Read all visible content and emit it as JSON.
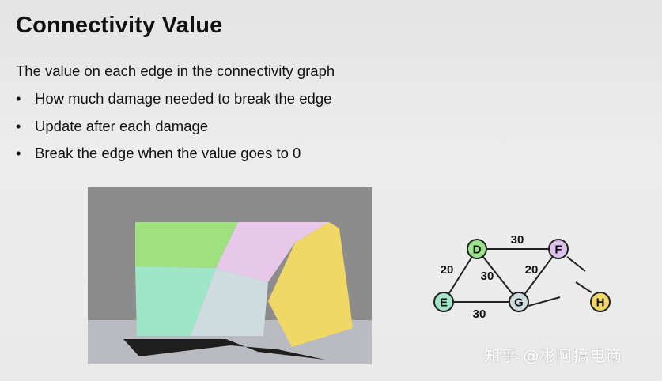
{
  "slide": {
    "title": "Connectivity Value",
    "intro": "The value on each edge in the connectivity graph",
    "bullets": [
      {
        "marker": "•",
        "text": "How much damage needed to break the edge"
      },
      {
        "marker": "•",
        "text": "Update after each damage"
      },
      {
        "marker": "•",
        "text": "Break the edge when the value goes to 0"
      }
    ]
  },
  "figure": {
    "piece_colors": {
      "green": "#9fe07f",
      "pink": "#e8c8e8",
      "teal": "#9fe6c8",
      "gray": "#cfdcdf",
      "yellow": "#f0d866"
    }
  },
  "graph": {
    "nodes": [
      {
        "id": "D",
        "color": "#9be38a"
      },
      {
        "id": "F",
        "color": "#dcc2ec"
      },
      {
        "id": "E",
        "color": "#9fe6c8"
      },
      {
        "id": "G",
        "color": "#cfdcdf"
      },
      {
        "id": "H",
        "color": "#f0d866"
      }
    ],
    "edges": [
      {
        "from": "D",
        "to": "F",
        "label": "30"
      },
      {
        "from": "D",
        "to": "E",
        "label": "20"
      },
      {
        "from": "D",
        "to": "G",
        "label": "30"
      },
      {
        "from": "F",
        "to": "G",
        "label": "20"
      },
      {
        "from": "E",
        "to": "G",
        "label": "30"
      }
    ]
  },
  "watermark": "知乎 @彬阿搞电商"
}
